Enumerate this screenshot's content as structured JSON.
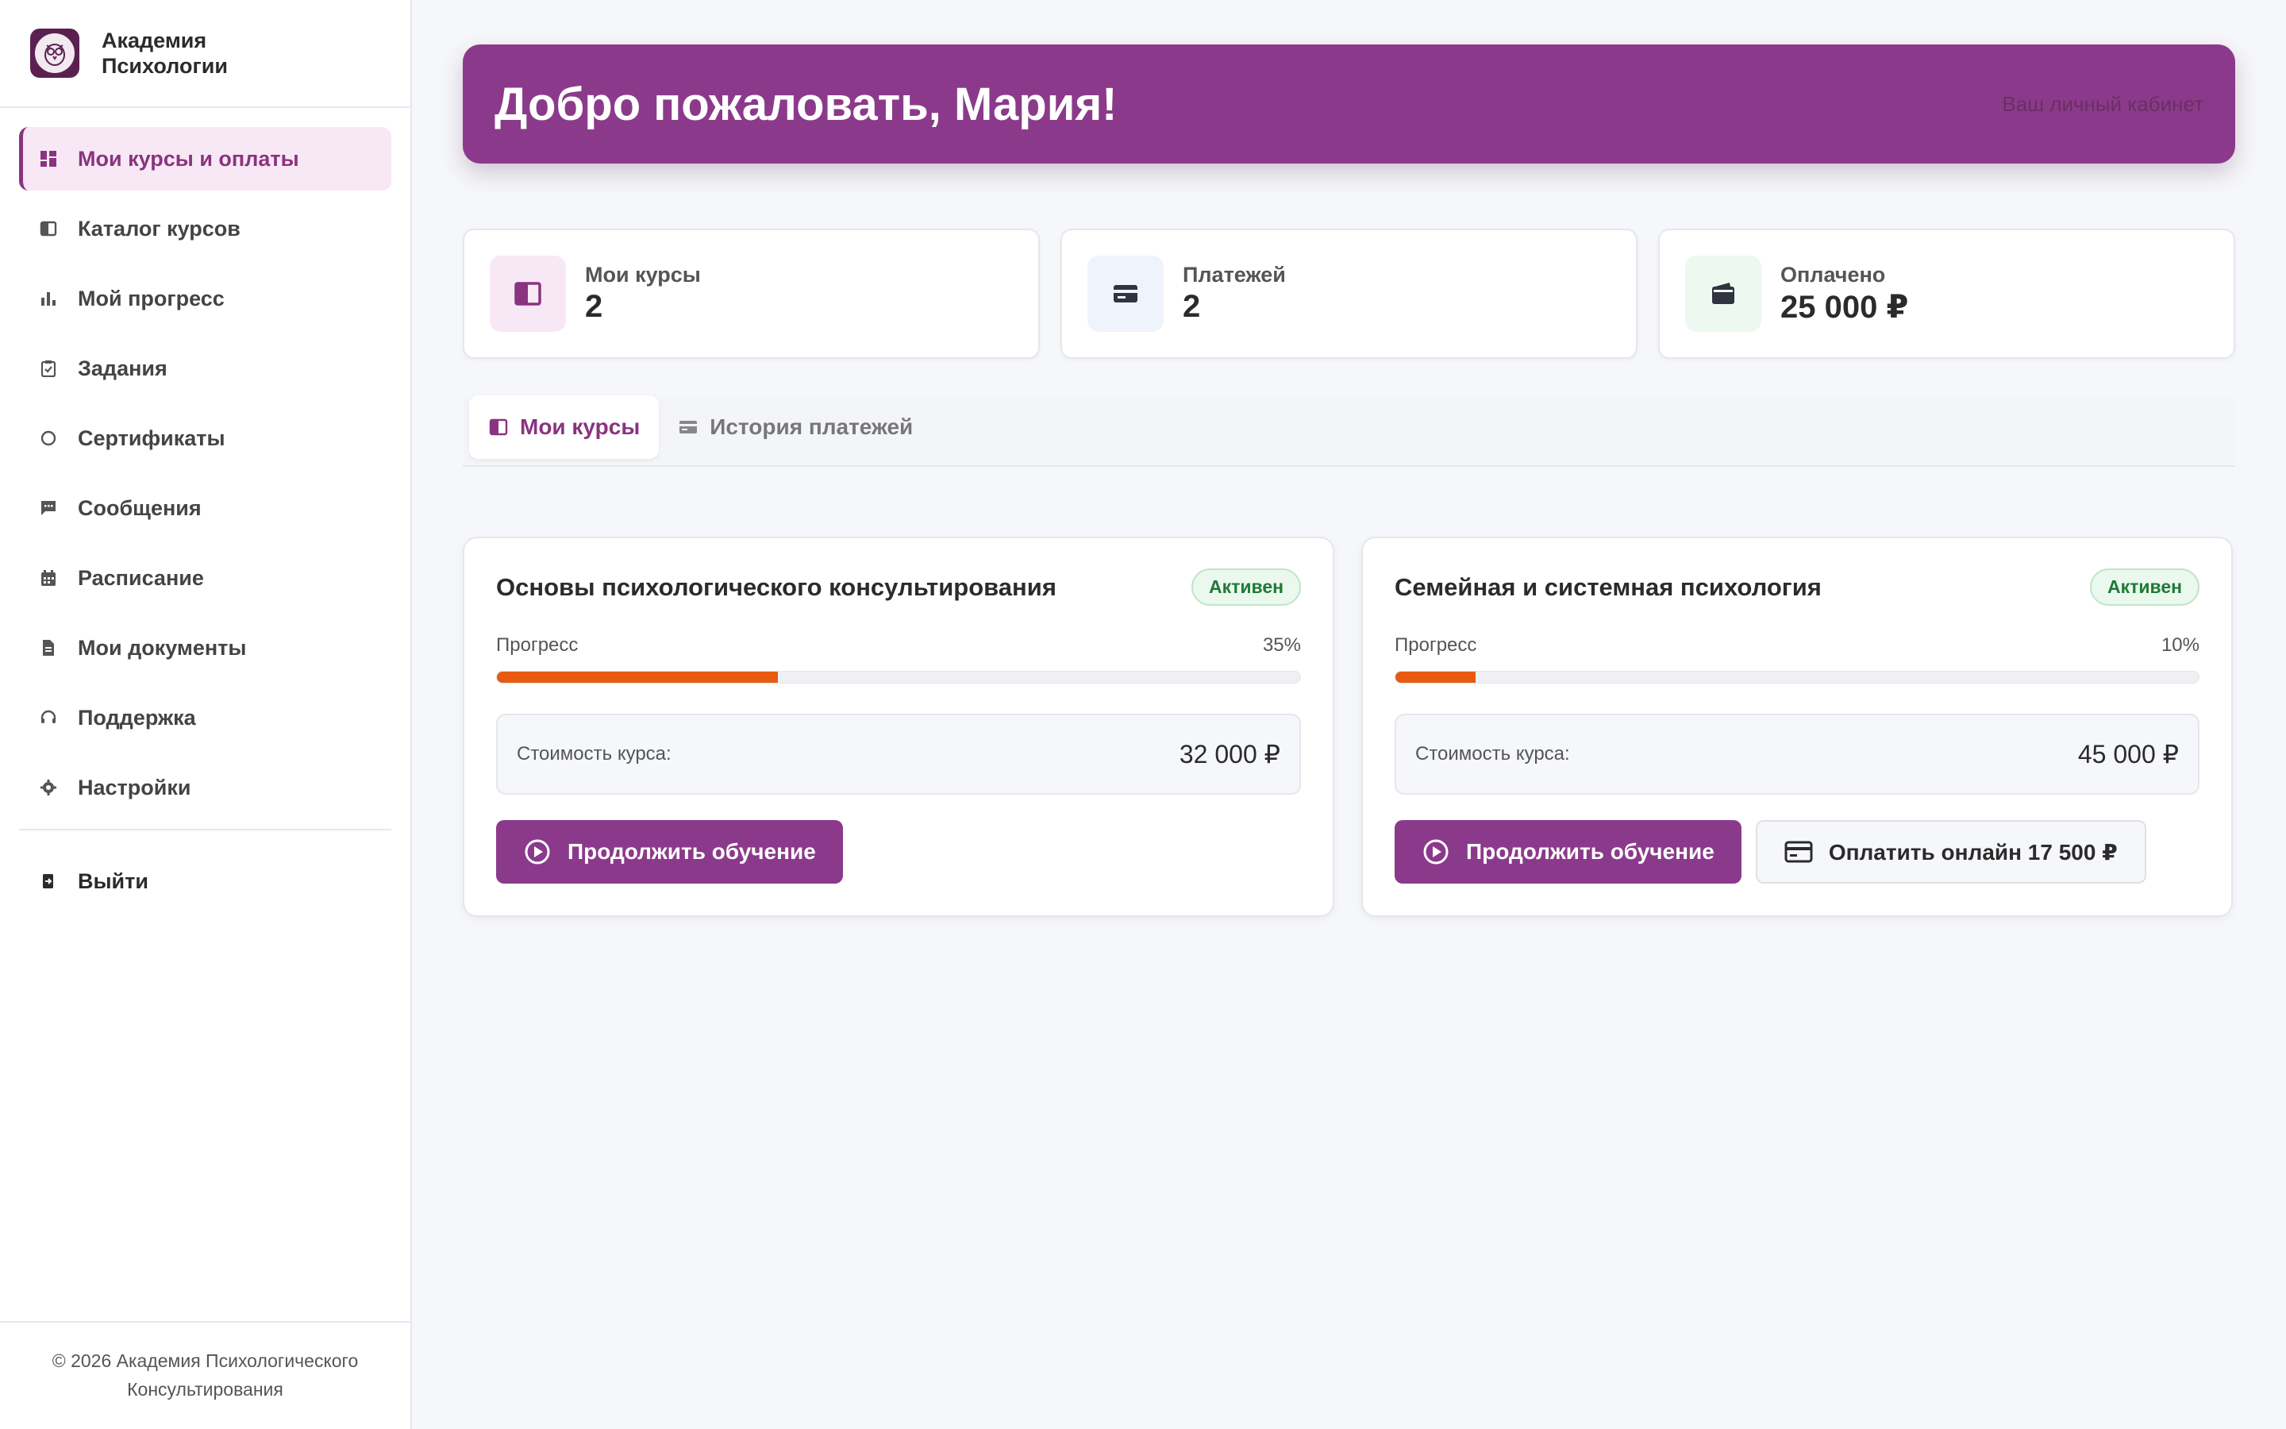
{
  "brand": {
    "name": "Академия Психологии"
  },
  "sidebar": {
    "items": [
      {
        "label": "Мои курсы и оплаты",
        "icon": "dashboard-icon"
      },
      {
        "label": "Каталог курсов",
        "icon": "book-icon"
      },
      {
        "label": "Мой прогресс",
        "icon": "bar-chart-icon"
      },
      {
        "label": "Задания",
        "icon": "clipboard-check-icon"
      },
      {
        "label": "Сертификаты",
        "icon": "certificate-icon"
      },
      {
        "label": "Сообщения",
        "icon": "message-icon"
      },
      {
        "label": "Расписание",
        "icon": "calendar-icon"
      },
      {
        "label": "Мои документы",
        "icon": "document-icon"
      },
      {
        "label": "Поддержка",
        "icon": "headset-icon"
      },
      {
        "label": "Настройки",
        "icon": "gear-icon"
      }
    ],
    "logout": {
      "label": "Выйти",
      "icon": "logout-icon"
    },
    "footer": "© 2026 Академия Психологического Консультирования"
  },
  "hero": {
    "title": "Добро пожаловать, Мария!",
    "subtitle": "Ваш личный кабинет"
  },
  "stats": [
    {
      "label": "Мои курсы",
      "value": "2",
      "icon": "book-icon"
    },
    {
      "label": "Платежей",
      "value": "2",
      "icon": "credit-card-icon"
    },
    {
      "label": "Оплачено",
      "value": "25 000 ₽",
      "icon": "wallet-icon"
    }
  ],
  "tabs": [
    {
      "label": "Мои курсы",
      "icon": "book-icon"
    },
    {
      "label": "История платежей",
      "icon": "credit-card-icon"
    }
  ],
  "courses": [
    {
      "title": "Основы психологического консультирования",
      "status": "Активен",
      "progress_label": "Прогресс",
      "progress_text": "35%",
      "progress": 0.35,
      "price_label": "Стоимость курса:",
      "price": "32 000 ₽",
      "continue_label": "Продолжить обучение"
    },
    {
      "title": "Семейная и системная психология",
      "status": "Активен",
      "progress_label": "Прогресс",
      "progress_text": "10%",
      "progress": 0.1,
      "price_label": "Стоимость курса:",
      "price": "45 000 ₽",
      "continue_label": "Продолжить обучение",
      "pay_label": "Оплатить онлайн 17 500 ₽"
    }
  ],
  "colors": {
    "accent": "#8b3a8b",
    "progress": "#e85a10",
    "active_badge": "#1f7a35"
  }
}
